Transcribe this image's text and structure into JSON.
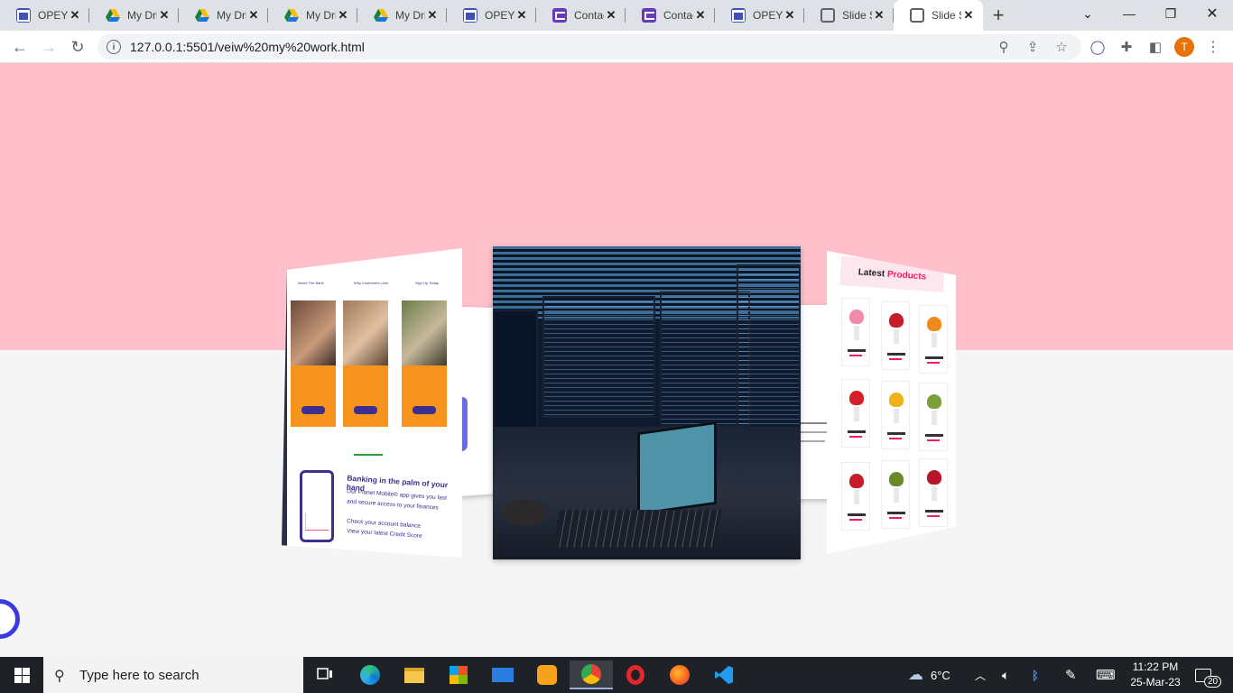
{
  "browser": {
    "tabs": [
      {
        "title": "OPEYEMI",
        "favicon": "forms-icon"
      },
      {
        "title": "My Drive",
        "favicon": "drive-icon"
      },
      {
        "title": "My Drive",
        "favicon": "drive-icon"
      },
      {
        "title": "My Drive",
        "favicon": "drive-icon"
      },
      {
        "title": "My Drive",
        "favicon": "drive-icon"
      },
      {
        "title": "OPEYEMI",
        "favicon": "forms-icon"
      },
      {
        "title": "Contact",
        "favicon": "contact-form-icon"
      },
      {
        "title": "Contact",
        "favicon": "contact-form-icon"
      },
      {
        "title": "OPEYEMI",
        "favicon": "forms-icon"
      },
      {
        "title": "Slide Show",
        "favicon": "globe-icon"
      },
      {
        "title": "Slide Show",
        "favicon": "globe-icon",
        "active": true
      }
    ],
    "new_tab": "+",
    "address": "127.0.0.1:5501/veiw%20my%20work.html",
    "profile_initial": "T"
  },
  "slides": {
    "left": {
      "headings": [
        "About The Bank",
        "Why Customers Love",
        "Sign Up Today"
      ],
      "bank_title": "Banking in the palm of your hand",
      "bank_lines": [
        "Our Planet Mobile® app gives you fast",
        "and secure access to your finances",
        "Check your account balance",
        "View your latest Credit Score"
      ]
    },
    "right": {
      "title_plain": "Latest ",
      "title_accent": "Products"
    }
  },
  "taskbar": {
    "search_placeholder": "Type here to search",
    "weather": "6°C",
    "time": "11:22 PM",
    "date": "25-Mar-23",
    "notifications": "20"
  },
  "colors": {
    "pink": "#ffc0cb",
    "accent": "#e91e63",
    "bank_purple": "#3b2f8f",
    "bank_orange": "#f7941d"
  }
}
